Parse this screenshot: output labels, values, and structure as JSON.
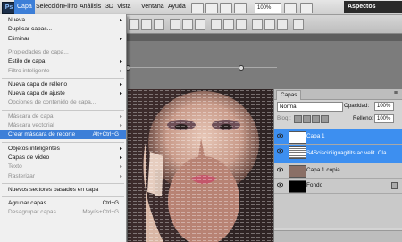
{
  "menubar": {
    "logo": "Ps",
    "items": [
      "Capa",
      "Selección",
      "Filtro",
      "Análisis",
      "3D",
      "Vista",
      "Ventana",
      "Ayuda"
    ],
    "zoom": "100%",
    "workspace": "Aspectos esenciales"
  },
  "menu": {
    "items": [
      {
        "label": "Nueva",
        "shortcut": "",
        "submenu": true,
        "disabled": false
      },
      {
        "label": "Duplicar capas...",
        "shortcut": "",
        "submenu": false,
        "disabled": false
      },
      {
        "label": "Eliminar",
        "shortcut": "",
        "submenu": true,
        "disabled": false
      },
      {
        "label": "Propiedades de capa...",
        "shortcut": "",
        "submenu": false,
        "disabled": true
      },
      {
        "label": "Estilo de capa",
        "shortcut": "",
        "submenu": true,
        "disabled": false
      },
      {
        "label": "Filtro inteligente",
        "shortcut": "",
        "submenu": true,
        "disabled": true
      },
      {
        "label": "Nueva capa de relleno",
        "shortcut": "",
        "submenu": true,
        "disabled": false
      },
      {
        "label": "Nueva capa de ajuste",
        "shortcut": "",
        "submenu": true,
        "disabled": false
      },
      {
        "label": "Opciones de contenido de capa...",
        "shortcut": "",
        "submenu": false,
        "disabled": true
      },
      {
        "label": "Máscara de capa",
        "shortcut": "",
        "submenu": true,
        "disabled": true
      },
      {
        "label": "Máscara vectorial",
        "shortcut": "",
        "submenu": true,
        "disabled": true
      },
      {
        "label": "Crear máscara de recorte",
        "shortcut": "Alt+Ctrl+G",
        "submenu": false,
        "disabled": false,
        "highlighted": true
      },
      {
        "label": "Objetos inteligentes",
        "shortcut": "",
        "submenu": true,
        "disabled": false
      },
      {
        "label": "Capas de vídeo",
        "shortcut": "",
        "submenu": true,
        "disabled": false
      },
      {
        "label": "Texto",
        "shortcut": "",
        "submenu": true,
        "disabled": true
      },
      {
        "label": "Rasterizar",
        "shortcut": "",
        "submenu": true,
        "disabled": true
      },
      {
        "label": "Nuevos sectores basados en capa",
        "shortcut": "",
        "submenu": false,
        "disabled": false
      },
      {
        "label": "Agrupar capas",
        "shortcut": "Ctrl+G",
        "submenu": false,
        "disabled": false
      },
      {
        "label": "Desagrupar capas",
        "shortcut": "Mayús+Ctrl+G",
        "submenu": false,
        "disabled": true
      }
    ]
  },
  "layers_panel": {
    "tab": "Capas",
    "blend_mode": "Normal",
    "opacity_label": "Opacidad:",
    "opacity_value": "100%",
    "lock_label": "Bloq.:",
    "fill_label": "Relleno:",
    "fill_value": "100%",
    "layers": [
      {
        "name": "Capa 1",
        "selected": true,
        "kind": "white"
      },
      {
        "name": "S4Scisciniiguagitits ac velit. Cla...",
        "selected": true,
        "kind": "text"
      },
      {
        "name": "Capa 1 copia",
        "selected": false,
        "kind": "photo"
      },
      {
        "name": "Fondo",
        "selected": false,
        "kind": "black",
        "locked": true
      }
    ]
  },
  "colors": {
    "highlight": "#3d7fd8",
    "menu_bg": "#f0f0f0",
    "canvas_bg": "#7c7c7c"
  }
}
